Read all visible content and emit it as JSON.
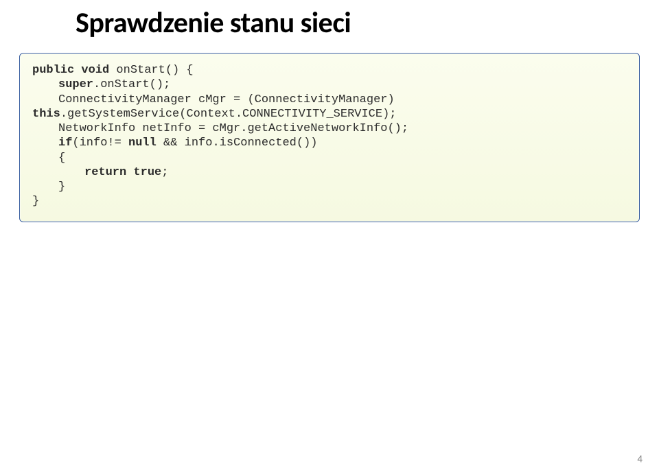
{
  "title": "Sprawdzenie stanu sieci",
  "code": {
    "l1a": "public void",
    "l1b": " onStart() {",
    "l2a": "super",
    "l2b": ".onStart();",
    "l3": "ConnectivityManager cMgr = (ConnectivityManager)",
    "l4a": "this",
    "l4b": ".getSystemService(Context.CONNECTIVITY_SERVICE);",
    "l5": "NetworkInfo netInfo = cMgr.getActiveNetworkInfo();",
    "l6a": "if",
    "l6b": "(info!= ",
    "l6c": "null",
    "l6d": " && info.isConnected())",
    "l7": "{",
    "l8a": "return true",
    "l8b": ";",
    "l9": "}",
    "l10": "}"
  },
  "page_number": "4"
}
